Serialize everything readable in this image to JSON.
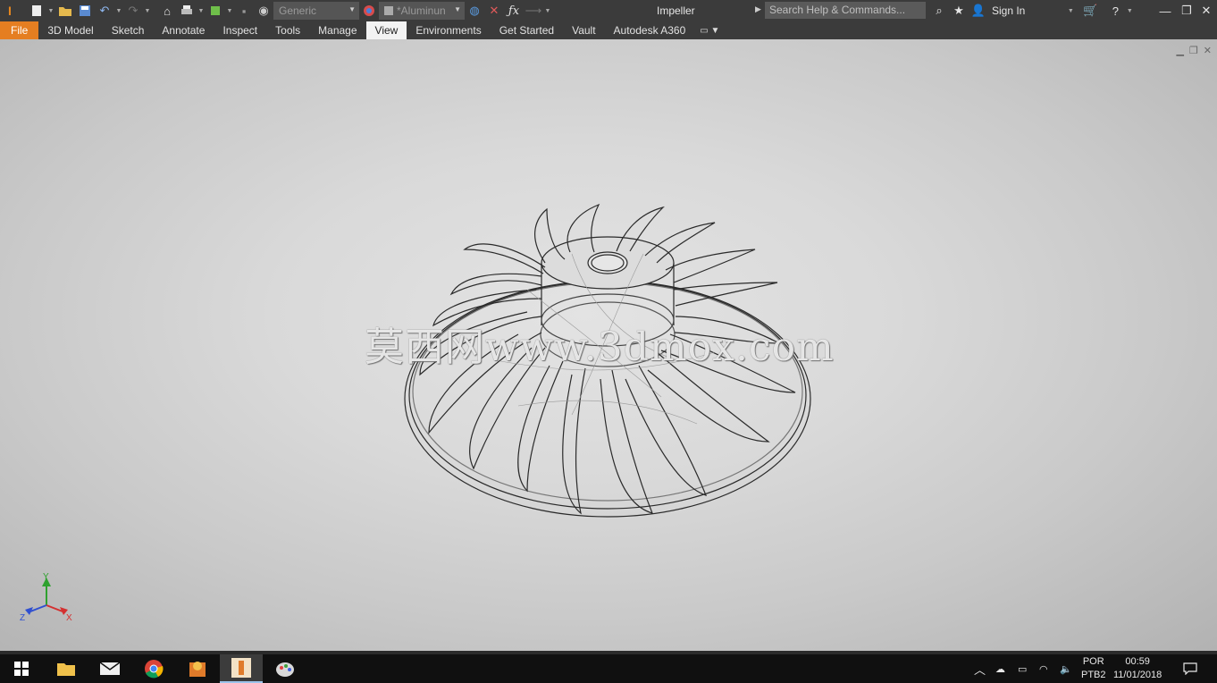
{
  "titlebar": {
    "app_logo": "inventor-pro-logo",
    "material_dropdown_value": "Generic",
    "appearance_dropdown_value": "*Aluminun",
    "doc_title": "Impeller",
    "search_placeholder": "Search Help & Commands...",
    "sign_in_label": "Sign In"
  },
  "ribbon": {
    "tabs": [
      {
        "label": "File"
      },
      {
        "label": "3D Model"
      },
      {
        "label": "Sketch"
      },
      {
        "label": "Annotate"
      },
      {
        "label": "Inspect"
      },
      {
        "label": "Tools"
      },
      {
        "label": "Manage"
      },
      {
        "label": "View"
      },
      {
        "label": "Environments"
      },
      {
        "label": "Get Started"
      },
      {
        "label": "Vault"
      },
      {
        "label": "Autodesk A360"
      }
    ],
    "active_tab": "View"
  },
  "viewport": {
    "model": "Impeller",
    "watermark": "莫西网www.3dmox.com",
    "triad": {
      "x": "X",
      "y": "Y",
      "z": "Z"
    },
    "colors": {
      "x_axis": "#d43030",
      "y_axis": "#2fa12f",
      "z_axis": "#3050d0"
    }
  },
  "taskbar": {
    "lang_line1": "POR",
    "lang_line2": "PTB2",
    "time": "00:59",
    "date": "11/01/2018"
  },
  "colors": {
    "accent_file_tab": "#e57e21",
    "titlebar_bg": "#3b3b3b",
    "taskbar_bg": "#101010"
  }
}
